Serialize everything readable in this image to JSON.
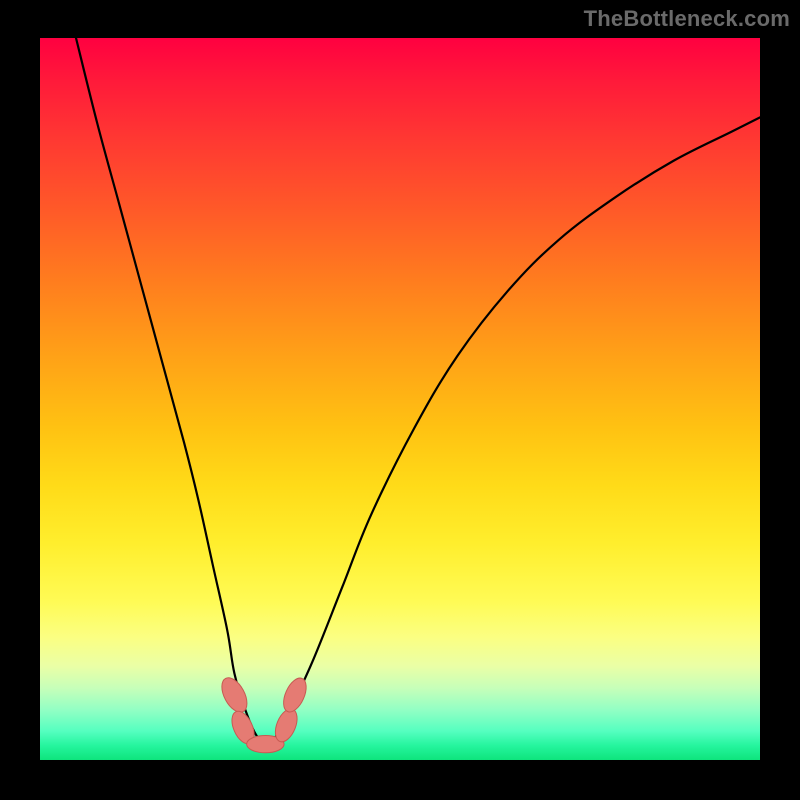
{
  "watermark": "TheBottleneck.com",
  "colors": {
    "background": "#000000",
    "curve": "#000000",
    "marker_fill": "#e57b73",
    "marker_stroke": "#c75a52",
    "watermark": "#6a6a6a"
  },
  "chart_data": {
    "type": "line",
    "title": "",
    "xlabel": "",
    "ylabel": "",
    "xlim": [
      0,
      100
    ],
    "ylim": [
      0,
      100
    ],
    "grid": false,
    "legend": false,
    "note": "Axes are unlabeled; all values below are estimated from pixel positions relative to the plot area (both axes normalized 0–100, origin bottom-left).",
    "series": [
      {
        "name": "bottleneck-curve",
        "x": [
          5,
          8,
          11,
          14,
          17,
          20,
          22,
          24,
          26,
          27,
          28.5,
          30,
          31.5,
          33,
          35,
          38,
          42,
          46,
          52,
          58,
          65,
          72,
          80,
          88,
          96,
          100
        ],
        "y": [
          100,
          88,
          77,
          66,
          55,
          44,
          36,
          27,
          18,
          12,
          7,
          3.5,
          2.2,
          3.6,
          7.5,
          14,
          24,
          34,
          46,
          56,
          65,
          72,
          78,
          83,
          87,
          89
        ]
      }
    ],
    "markers": [
      {
        "name": "marker-left-upper",
        "x": 27.0,
        "y": 9.0,
        "rx": 1.4,
        "ry": 2.6,
        "angle": -28
      },
      {
        "name": "marker-left-lower",
        "x": 28.2,
        "y": 4.5,
        "rx": 1.3,
        "ry": 2.4,
        "angle": -24
      },
      {
        "name": "marker-bottom",
        "x": 31.3,
        "y": 2.2,
        "rx": 2.6,
        "ry": 1.2,
        "angle": 0
      },
      {
        "name": "marker-right-lower",
        "x": 34.2,
        "y": 4.8,
        "rx": 1.3,
        "ry": 2.4,
        "angle": 22
      },
      {
        "name": "marker-right-upper",
        "x": 35.4,
        "y": 9.0,
        "rx": 1.3,
        "ry": 2.5,
        "angle": 24
      }
    ]
  }
}
